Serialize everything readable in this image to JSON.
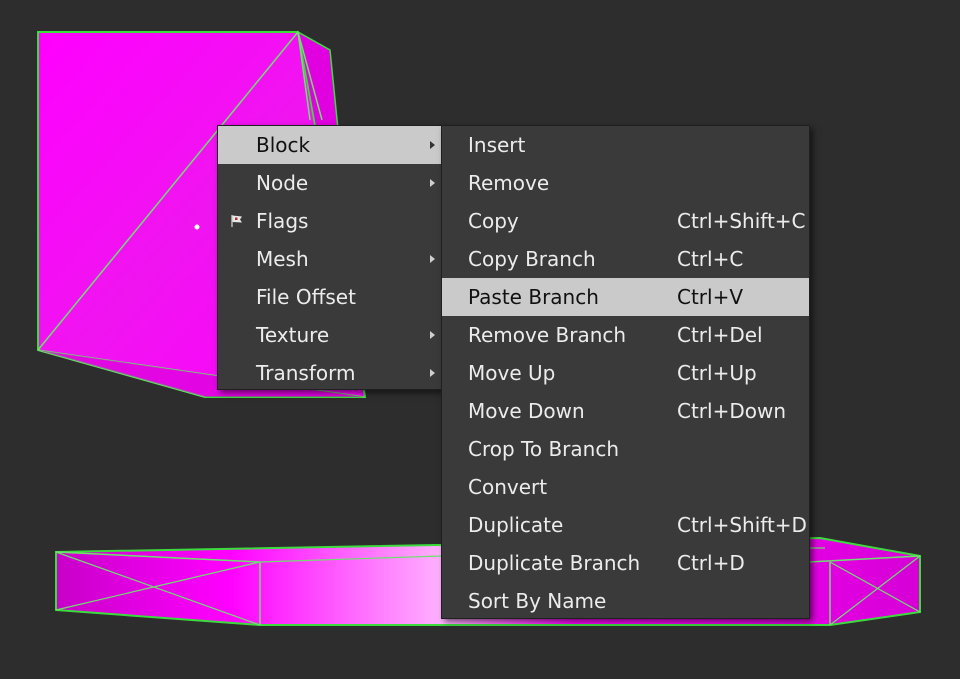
{
  "colors": {
    "background": "#2d2d2d",
    "mesh_fill": "#ff00ff",
    "mesh_edge": "#3ddc3d",
    "menu_bg": "#3a3a3a",
    "menu_highlight": "#cacaca",
    "menu_text": "#ececec"
  },
  "context_menu": {
    "items": [
      {
        "label": "Block",
        "has_submenu": true,
        "active": true
      },
      {
        "label": "Node",
        "has_submenu": true
      },
      {
        "label": "Flags",
        "icon": "flag-icon"
      },
      {
        "label": "Mesh",
        "has_submenu": true
      },
      {
        "label": "File Offset"
      },
      {
        "label": "Texture",
        "has_submenu": true
      },
      {
        "label": "Transform",
        "has_submenu": true
      }
    ]
  },
  "block_submenu": {
    "items": [
      {
        "label": "Insert",
        "shortcut": ""
      },
      {
        "label": "Remove",
        "shortcut": ""
      },
      {
        "label": "Copy",
        "shortcut": "Ctrl+Shift+C"
      },
      {
        "label": "Copy Branch",
        "shortcut": "Ctrl+C"
      },
      {
        "label": "Paste Branch",
        "shortcut": "Ctrl+V",
        "active": true
      },
      {
        "label": "Remove Branch",
        "shortcut": "Ctrl+Del"
      },
      {
        "label": "Move Up",
        "shortcut": "Ctrl+Up"
      },
      {
        "label": "Move Down",
        "shortcut": "Ctrl+Down"
      },
      {
        "label": "Crop To Branch",
        "shortcut": ""
      },
      {
        "label": "Convert",
        "shortcut": ""
      },
      {
        "label": "Duplicate",
        "shortcut": "Ctrl+Shift+D"
      },
      {
        "label": "Duplicate Branch",
        "shortcut": "Ctrl+D"
      },
      {
        "label": "Sort By Name",
        "shortcut": ""
      }
    ]
  }
}
